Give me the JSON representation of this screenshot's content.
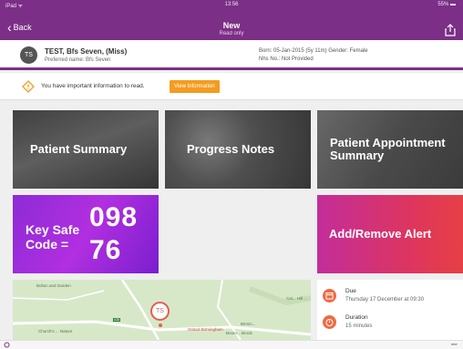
{
  "status": {
    "left": "iPad ᯤ",
    "time": "13:56",
    "battery": "55% ▬"
  },
  "nav": {
    "back_label": "Back",
    "title": "New",
    "subtitle": "Read only"
  },
  "patient": {
    "initials": "TS",
    "name": "TEST, Bfs Seven, (Miss)",
    "preferred": "Preferred name: Bfs Seven",
    "born": "Born: 05-Jan-2015 (5y 11m)   Gender: Female",
    "nhs": "Nhs No.: Not Provided"
  },
  "alert": {
    "text": "You have important information to read.",
    "button_label": "View Information"
  },
  "tiles": {
    "patient_summary": "Patient Summary",
    "progress_notes": "Progress Notes",
    "patient_appointment_summary": "Patient Appointment Summary",
    "key_safe_label": "Key Safe Code =",
    "key_safe_code_1": "098",
    "key_safe_code_2": "76",
    "add_remove_alert": "Add/Remove Alert"
  },
  "map": {
    "pin_label": "TS",
    "labels": [
      "Bolton and Garden",
      "Church's ... Nature",
      "Cal... Hill ...",
      "Birmin...",
      "Bourn... Brook",
      "Orsted Birmingham",
      "A38"
    ]
  },
  "appointment": {
    "due_title": "Due",
    "due_value": "Thursday 17 December at 09:30",
    "duration_title": "Duration",
    "duration_value": "15 minutes"
  },
  "colors": {
    "brand": "#7b2f86",
    "accent": "#f39c20",
    "alert_gradient_end": "#e64045"
  }
}
